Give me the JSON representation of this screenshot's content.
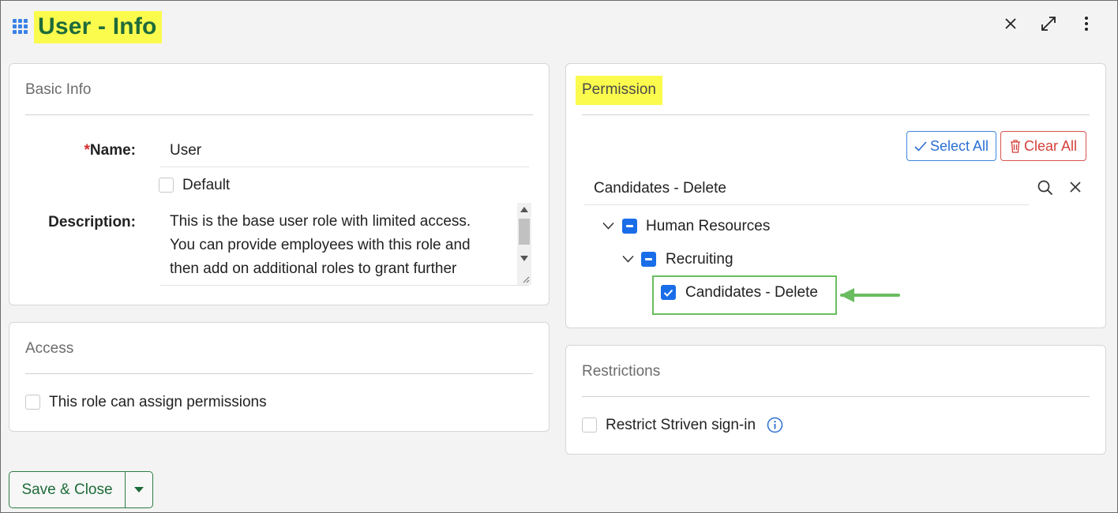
{
  "header": {
    "title": "User - Info",
    "icons": {
      "menu": "grid-icon",
      "close": "close-icon",
      "expand": "expand-icon",
      "more": "more-vertical-icon"
    }
  },
  "basic_info": {
    "title": "Basic Info",
    "name_required_mark": "*",
    "name_label": "Name:",
    "name_value": "User",
    "default_label": "Default",
    "description_label": "Description:",
    "description_lines": [
      "This is the base user role with limited access.",
      "You can provide employees with this role and",
      "then add on additional roles to grant further"
    ]
  },
  "access": {
    "title": "Access",
    "assign_permissions_label": "This role can assign permissions"
  },
  "permission": {
    "title": "Permission",
    "select_all_label": "Select All",
    "clear_all_label": "Clear All",
    "search_value": "Candidates - Delete",
    "tree": {
      "level1": "Human Resources",
      "level2": "Recruiting",
      "level3": "Candidates - Delete"
    }
  },
  "restrictions": {
    "title": "Restrictions",
    "restrict_signin_label": "Restrict Striven sign-in"
  },
  "footer": {
    "save_label": "Save & Close"
  },
  "colors": {
    "accent_green": "#1e6b3a",
    "highlight_yellow": "#fbfb4d",
    "checkbox_blue": "#1a6de8",
    "callout_green": "#6abd5f"
  }
}
